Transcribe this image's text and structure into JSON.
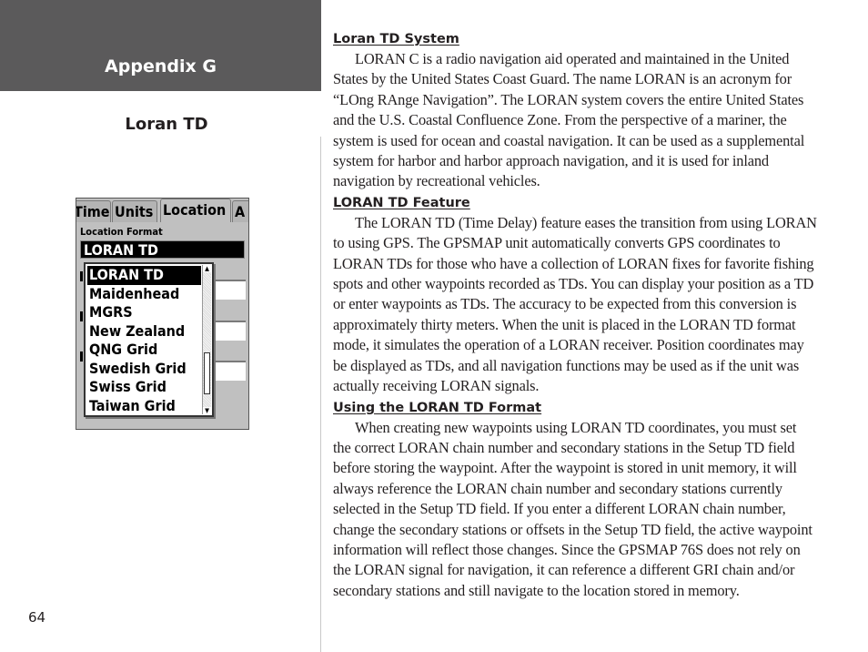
{
  "header": {
    "appendix_title": "Appendix G",
    "section_title": "Loran TD"
  },
  "page_number": "64",
  "device_screen": {
    "tabs": [
      {
        "label": "Time",
        "active": false
      },
      {
        "label": "Units",
        "active": false
      },
      {
        "label": "Location",
        "active": true
      },
      {
        "label": "A",
        "active": false
      }
    ],
    "location_format_label": "Location Format",
    "location_format_value": "LORAN TD",
    "dropdown_options": [
      {
        "label": "LORAN TD",
        "selected": true
      },
      {
        "label": "Maidenhead",
        "selected": false
      },
      {
        "label": "MGRS",
        "selected": false
      },
      {
        "label": "New Zealand",
        "selected": false
      },
      {
        "label": "QNG Grid",
        "selected": false
      },
      {
        "label": "Swedish Grid",
        "selected": false
      },
      {
        "label": "Swiss Grid",
        "selected": false
      },
      {
        "label": "Taiwan Grid",
        "selected": false
      }
    ],
    "icons": {
      "scroll_up": "▲",
      "scroll_down": "▼"
    }
  },
  "sections": [
    {
      "heading": "Loran TD System",
      "body": "LORAN C is a radio navigation aid operated and maintained in the United States by the United States Coast Guard. The name LORAN is an acronym for “LOng RAnge Navigation”. The LORAN system covers the entire United States and the U.S. Coastal Confluence Zone. From the perspective of a mariner, the system is used for ocean and coastal navigation. It can be used as a supplemental system for harbor and harbor approach navigation, and it is used for inland navigation by recreational vehicles."
    },
    {
      "heading": "LORAN TD Feature",
      "body": "The LORAN TD (Time Delay) feature eases the transition from using LORAN to using GPS. The GPSMAP unit automatically converts GPS coordinates to LORAN TDs for those who have a collection of LORAN fixes for favorite fishing spots and other waypoints recorded as TDs. You can display your position as a TD or enter waypoints as TDs. The accuracy to be expected from this conversion is approximately thirty meters. When the unit is placed in the LORAN TD format mode, it simulates the operation of a LORAN receiver. Position coordinates may be displayed as TDs, and all navigation functions may be used as if the unit was actually receiving LORAN signals."
    },
    {
      "heading": "Using the LORAN TD Format",
      "body": "When creating new waypoints using LORAN TD coordinates, you must set the correct LORAN chain number and secondary stations in the Setup TD field before storing the waypoint. After the waypoint is stored in unit memory, it will always reference the LORAN chain number and secondary stations currently selected in the Setup TD field. If you enter a different LORAN chain number, change the secondary stations or offsets in the Setup TD field, the active waypoint information will reflect those changes. Since the GPSMAP 76S does not rely on the LORAN signal for navigation, it can reference a different GRI chain and/or secondary stations and still navigate to the location stored in memory."
    }
  ]
}
